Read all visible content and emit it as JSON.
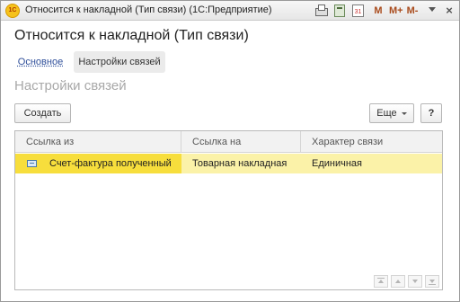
{
  "window": {
    "app_logo_text": "1С",
    "title": "Относится к накладной (Тип связи)  (1С:Предприятие)",
    "titlebar_icons": [
      "print-icon",
      "calculator-icon",
      "calendar-icon",
      "memory-m-icon",
      "memory-m-plus-icon",
      "memory-m-minus-icon",
      "window-menu-icon",
      "close-icon"
    ],
    "calendar_day": "31",
    "m_label": "M",
    "m_plus_label": "M+",
    "m_minus_label": "M-",
    "close_glyph": "×"
  },
  "form": {
    "title": "Относится к накладной (Тип связи)",
    "tabs": [
      {
        "label": "Основное",
        "active": false
      },
      {
        "label": "Настройки связей",
        "active": true
      }
    ],
    "section_title": "Настройки связей"
  },
  "toolbar": {
    "create_label": "Создать",
    "more_label": "Еще",
    "help_label": "?"
  },
  "table": {
    "columns": [
      "Ссылка из",
      "Ссылка на",
      "Характер связи"
    ],
    "rows": [
      {
        "from": "Счет-фактура полученный",
        "to": "Товарная накладная",
        "kind": "Единичная",
        "icon": "document-icon",
        "selected": true
      }
    ]
  },
  "colors": {
    "selected_row": "#fbf2a8",
    "selected_cell": "#f7de3c",
    "link": "#2f4f9a",
    "section_title": "#a8a8a8"
  }
}
